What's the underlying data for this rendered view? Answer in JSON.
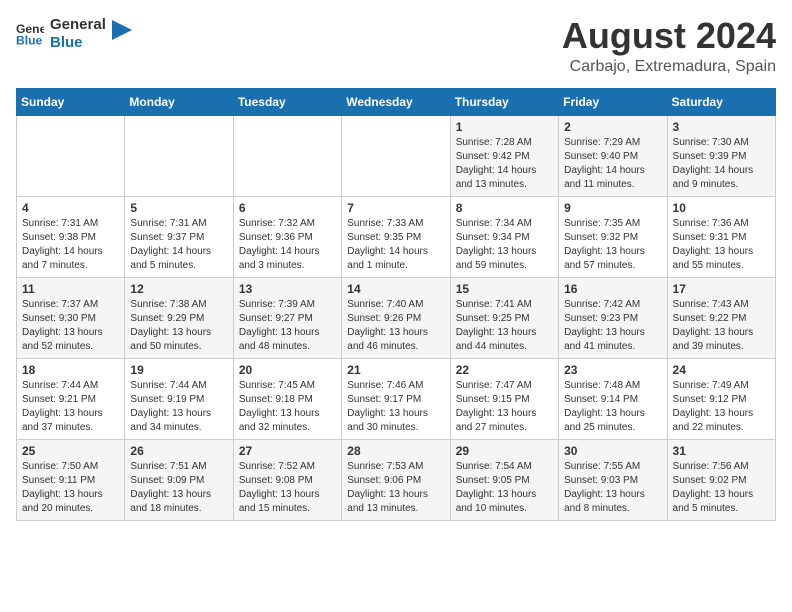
{
  "header": {
    "logo_line1": "General",
    "logo_line2": "Blue",
    "main_title": "August 2024",
    "subtitle": "Carbajo, Extremadura, Spain"
  },
  "calendar": {
    "days_of_week": [
      "Sunday",
      "Monday",
      "Tuesday",
      "Wednesday",
      "Thursday",
      "Friday",
      "Saturday"
    ],
    "weeks": [
      [
        {
          "day": "",
          "info": ""
        },
        {
          "day": "",
          "info": ""
        },
        {
          "day": "",
          "info": ""
        },
        {
          "day": "",
          "info": ""
        },
        {
          "day": "1",
          "info": "Sunrise: 7:28 AM\nSunset: 9:42 PM\nDaylight: 14 hours\nand 13 minutes."
        },
        {
          "day": "2",
          "info": "Sunrise: 7:29 AM\nSunset: 9:40 PM\nDaylight: 14 hours\nand 11 minutes."
        },
        {
          "day": "3",
          "info": "Sunrise: 7:30 AM\nSunset: 9:39 PM\nDaylight: 14 hours\nand 9 minutes."
        }
      ],
      [
        {
          "day": "4",
          "info": "Sunrise: 7:31 AM\nSunset: 9:38 PM\nDaylight: 14 hours\nand 7 minutes."
        },
        {
          "day": "5",
          "info": "Sunrise: 7:31 AM\nSunset: 9:37 PM\nDaylight: 14 hours\nand 5 minutes."
        },
        {
          "day": "6",
          "info": "Sunrise: 7:32 AM\nSunset: 9:36 PM\nDaylight: 14 hours\nand 3 minutes."
        },
        {
          "day": "7",
          "info": "Sunrise: 7:33 AM\nSunset: 9:35 PM\nDaylight: 14 hours\nand 1 minute."
        },
        {
          "day": "8",
          "info": "Sunrise: 7:34 AM\nSunset: 9:34 PM\nDaylight: 13 hours\nand 59 minutes."
        },
        {
          "day": "9",
          "info": "Sunrise: 7:35 AM\nSunset: 9:32 PM\nDaylight: 13 hours\nand 57 minutes."
        },
        {
          "day": "10",
          "info": "Sunrise: 7:36 AM\nSunset: 9:31 PM\nDaylight: 13 hours\nand 55 minutes."
        }
      ],
      [
        {
          "day": "11",
          "info": "Sunrise: 7:37 AM\nSunset: 9:30 PM\nDaylight: 13 hours\nand 52 minutes."
        },
        {
          "day": "12",
          "info": "Sunrise: 7:38 AM\nSunset: 9:29 PM\nDaylight: 13 hours\nand 50 minutes."
        },
        {
          "day": "13",
          "info": "Sunrise: 7:39 AM\nSunset: 9:27 PM\nDaylight: 13 hours\nand 48 minutes."
        },
        {
          "day": "14",
          "info": "Sunrise: 7:40 AM\nSunset: 9:26 PM\nDaylight: 13 hours\nand 46 minutes."
        },
        {
          "day": "15",
          "info": "Sunrise: 7:41 AM\nSunset: 9:25 PM\nDaylight: 13 hours\nand 44 minutes."
        },
        {
          "day": "16",
          "info": "Sunrise: 7:42 AM\nSunset: 9:23 PM\nDaylight: 13 hours\nand 41 minutes."
        },
        {
          "day": "17",
          "info": "Sunrise: 7:43 AM\nSunset: 9:22 PM\nDaylight: 13 hours\nand 39 minutes."
        }
      ],
      [
        {
          "day": "18",
          "info": "Sunrise: 7:44 AM\nSunset: 9:21 PM\nDaylight: 13 hours\nand 37 minutes."
        },
        {
          "day": "19",
          "info": "Sunrise: 7:44 AM\nSunset: 9:19 PM\nDaylight: 13 hours\nand 34 minutes."
        },
        {
          "day": "20",
          "info": "Sunrise: 7:45 AM\nSunset: 9:18 PM\nDaylight: 13 hours\nand 32 minutes."
        },
        {
          "day": "21",
          "info": "Sunrise: 7:46 AM\nSunset: 9:17 PM\nDaylight: 13 hours\nand 30 minutes."
        },
        {
          "day": "22",
          "info": "Sunrise: 7:47 AM\nSunset: 9:15 PM\nDaylight: 13 hours\nand 27 minutes."
        },
        {
          "day": "23",
          "info": "Sunrise: 7:48 AM\nSunset: 9:14 PM\nDaylight: 13 hours\nand 25 minutes."
        },
        {
          "day": "24",
          "info": "Sunrise: 7:49 AM\nSunset: 9:12 PM\nDaylight: 13 hours\nand 22 minutes."
        }
      ],
      [
        {
          "day": "25",
          "info": "Sunrise: 7:50 AM\nSunset: 9:11 PM\nDaylight: 13 hours\nand 20 minutes."
        },
        {
          "day": "26",
          "info": "Sunrise: 7:51 AM\nSunset: 9:09 PM\nDaylight: 13 hours\nand 18 minutes."
        },
        {
          "day": "27",
          "info": "Sunrise: 7:52 AM\nSunset: 9:08 PM\nDaylight: 13 hours\nand 15 minutes."
        },
        {
          "day": "28",
          "info": "Sunrise: 7:53 AM\nSunset: 9:06 PM\nDaylight: 13 hours\nand 13 minutes."
        },
        {
          "day": "29",
          "info": "Sunrise: 7:54 AM\nSunset: 9:05 PM\nDaylight: 13 hours\nand 10 minutes."
        },
        {
          "day": "30",
          "info": "Sunrise: 7:55 AM\nSunset: 9:03 PM\nDaylight: 13 hours\nand 8 minutes."
        },
        {
          "day": "31",
          "info": "Sunrise: 7:56 AM\nSunset: 9:02 PM\nDaylight: 13 hours\nand 5 minutes."
        }
      ]
    ]
  }
}
